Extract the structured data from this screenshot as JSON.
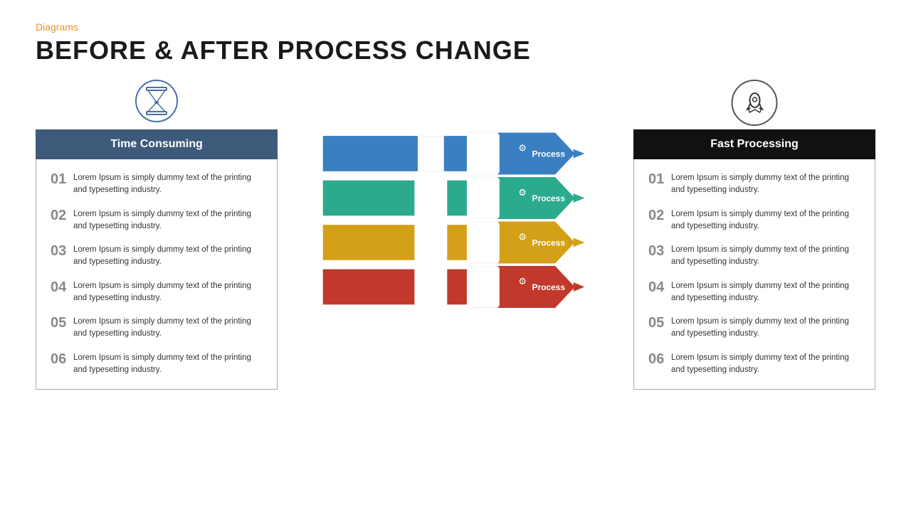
{
  "header": {
    "category": "Diagrams",
    "title": "BEFORE & AFTER PROCESS CHANGE"
  },
  "left": {
    "header": "Time Consuming",
    "icon": "hourglass",
    "items": [
      {
        "number": "01",
        "text": "Lorem Ipsum is simply dummy text of the printing and typesetting industry."
      },
      {
        "number": "02",
        "text": "Lorem Ipsum is simply dummy text of the printing and typesetting industry."
      },
      {
        "number": "03",
        "text": "Lorem Ipsum is simply dummy text of the printing and typesetting industry."
      },
      {
        "number": "04",
        "text": "Lorem Ipsum is simply dummy text of the printing and typesetting industry."
      },
      {
        "number": "05",
        "text": "Lorem Ipsum is simply dummy text of the printing and typesetting industry."
      },
      {
        "number": "06",
        "text": "Lorem Ipsum is simply dummy text of the printing and typesetting industry."
      }
    ]
  },
  "middle": {
    "arrows": [
      {
        "id": 1,
        "label": "Process",
        "color_main": "#3a7fc1",
        "color_dark": "#2a5f9e"
      },
      {
        "id": 2,
        "label": "Process",
        "color_main": "#2baa8e",
        "color_dark": "#1e8a72"
      },
      {
        "id": 3,
        "label": "Process",
        "color_main": "#d4a017",
        "color_dark": "#b88510"
      },
      {
        "id": 4,
        "label": "Process",
        "color_main": "#c0392b",
        "color_dark": "#9b2d23"
      }
    ]
  },
  "right": {
    "header": "Fast Processing",
    "icon": "rocket",
    "items": [
      {
        "number": "01",
        "text": "Lorem Ipsum is simply dummy text of the printing and typesetting industry."
      },
      {
        "number": "02",
        "text": "Lorem Ipsum is simply dummy text of the printing and typesetting industry."
      },
      {
        "number": "03",
        "text": "Lorem Ipsum is simply dummy text of the printing and typesetting industry."
      },
      {
        "number": "04",
        "text": "Lorem Ipsum is simply dummy text of the printing and typesetting industry."
      },
      {
        "number": "05",
        "text": "Lorem Ipsum is simply dummy text of the printing and typesetting industry."
      },
      {
        "number": "06",
        "text": "Lorem Ipsum is simply dummy text of the printing and typesetting industry."
      }
    ]
  },
  "colors": {
    "orange": "#E8922A",
    "dark": "#1a1a1a",
    "left_header_bg": "#3d5a7a",
    "right_header_bg": "#111111"
  }
}
